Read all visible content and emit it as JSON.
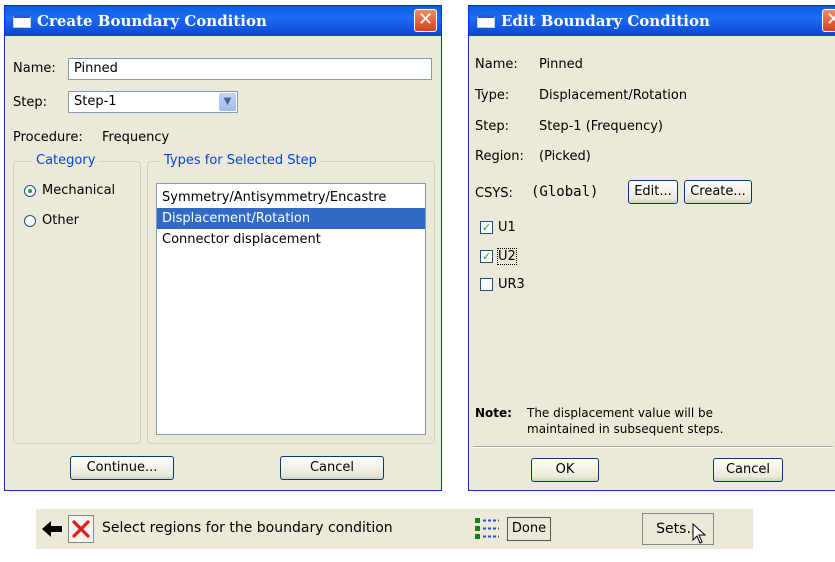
{
  "create_dialog": {
    "title": "Create Boundary Condition",
    "name_label": "Name:",
    "name_value": "Pinned",
    "step_label": "Step:",
    "step_value": "Step-1",
    "procedure_label": "Procedure:",
    "procedure_value": "Frequency",
    "category_legend": "Category",
    "categories": [
      {
        "label": "Mechanical",
        "selected": true
      },
      {
        "label": "Other",
        "selected": false
      }
    ],
    "types_legend": "Types for Selected Step",
    "types": [
      {
        "label": "Symmetry/Antisymmetry/Encastre",
        "selected": false
      },
      {
        "label": "Displacement/Rotation",
        "selected": true
      },
      {
        "label": "Connector displacement",
        "selected": false
      }
    ],
    "continue_label": "Continue...",
    "cancel_label": "Cancel"
  },
  "edit_dialog": {
    "title": "Edit Boundary Condition",
    "fields": [
      {
        "label": "Name:",
        "value": "Pinned"
      },
      {
        "label": "Type:",
        "value": "Displacement/Rotation"
      },
      {
        "label": "Step:",
        "value": "Step-1 (Frequency)"
      },
      {
        "label": "Region:",
        "value": "(Picked)"
      }
    ],
    "csys_label": "CSYS:",
    "csys_value": "(Global)",
    "edit_label": "Edit...",
    "create_label": "Create...",
    "dofs": [
      {
        "label": "U1",
        "checked": true
      },
      {
        "label": "U2",
        "checked": true
      },
      {
        "label": "UR3",
        "checked": false
      }
    ],
    "note_label": "Note:",
    "note_line1": "The displacement value will be",
    "note_line2": "maintained in subsequent steps.",
    "ok_label": "OK",
    "cancel_label": "Cancel"
  },
  "prompt_bar": {
    "prompt_text": "Select regions for the boundary condition",
    "done_label": "Done",
    "sets_label": "Sets..."
  },
  "colors": {
    "title_blue": "#0a5ee8",
    "selection_blue": "#316ac5",
    "dialog_bg": "#ece9d8",
    "close_red": "#d2431b"
  }
}
